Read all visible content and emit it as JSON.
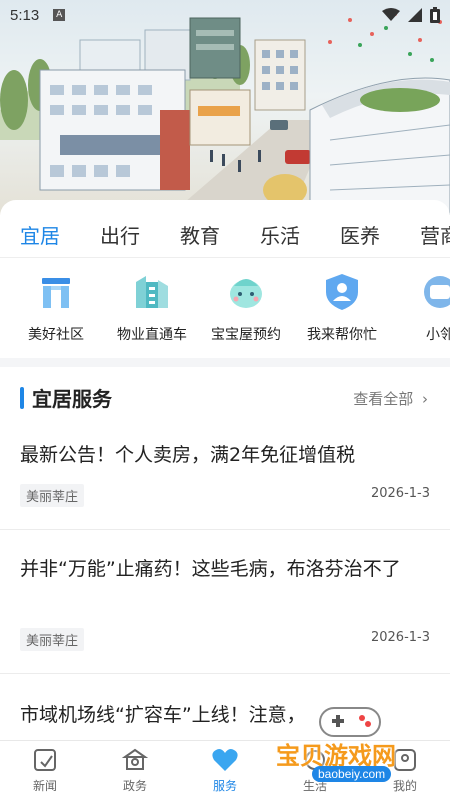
{
  "status_bar": {
    "time": "5:13",
    "notification_icon": "A"
  },
  "hero": {
    "image": "city-illustration"
  },
  "tabs": [
    {
      "label": "宜居",
      "active": true
    },
    {
      "label": "出行",
      "active": false
    },
    {
      "label": "教育",
      "active": false
    },
    {
      "label": "乐活",
      "active": false
    },
    {
      "label": "医养",
      "active": false
    },
    {
      "label": "营商",
      "active": false
    }
  ],
  "services": [
    {
      "label": "美好社区",
      "icon": "gate-icon"
    },
    {
      "label": "物业直通车",
      "icon": "buildings-icon"
    },
    {
      "label": "宝宝屋预约",
      "icon": "baby-icon"
    },
    {
      "label": "我来帮你忙",
      "icon": "shield-person-icon"
    },
    {
      "label": "小邻",
      "icon": "neighbor-icon"
    }
  ],
  "section": {
    "title": "宜居服务",
    "more": "查看全部"
  },
  "news": [
    {
      "title": "最新公告！个人卖房，满2年免征增值税",
      "tag": "美丽莘庄",
      "date": "2026-1-3"
    },
    {
      "title": "并非“万能”止痛药！这些毛病，布洛芬治不了",
      "tag": "美丽莘庄",
      "date": "2026-1-3"
    },
    {
      "title": "市域机场线“扩容车”上线！注意，",
      "tag": "",
      "date": ""
    }
  ],
  "bottom_nav": [
    {
      "label": "新闻",
      "icon": "news-icon",
      "active": false
    },
    {
      "label": "政务",
      "icon": "government-icon",
      "active": false
    },
    {
      "label": "服务",
      "icon": "heart-icon",
      "active": true
    },
    {
      "label": "生活",
      "icon": "life-icon",
      "active": false
    },
    {
      "label": "我的",
      "icon": "profile-icon",
      "active": false
    }
  ],
  "watermark": {
    "text": "宝贝游戏网",
    "url": "baobeiy.com"
  },
  "colors": {
    "accent": "#1e86e6",
    "text": "#222222",
    "muted": "#777777",
    "watermark": "#f59a1c"
  }
}
